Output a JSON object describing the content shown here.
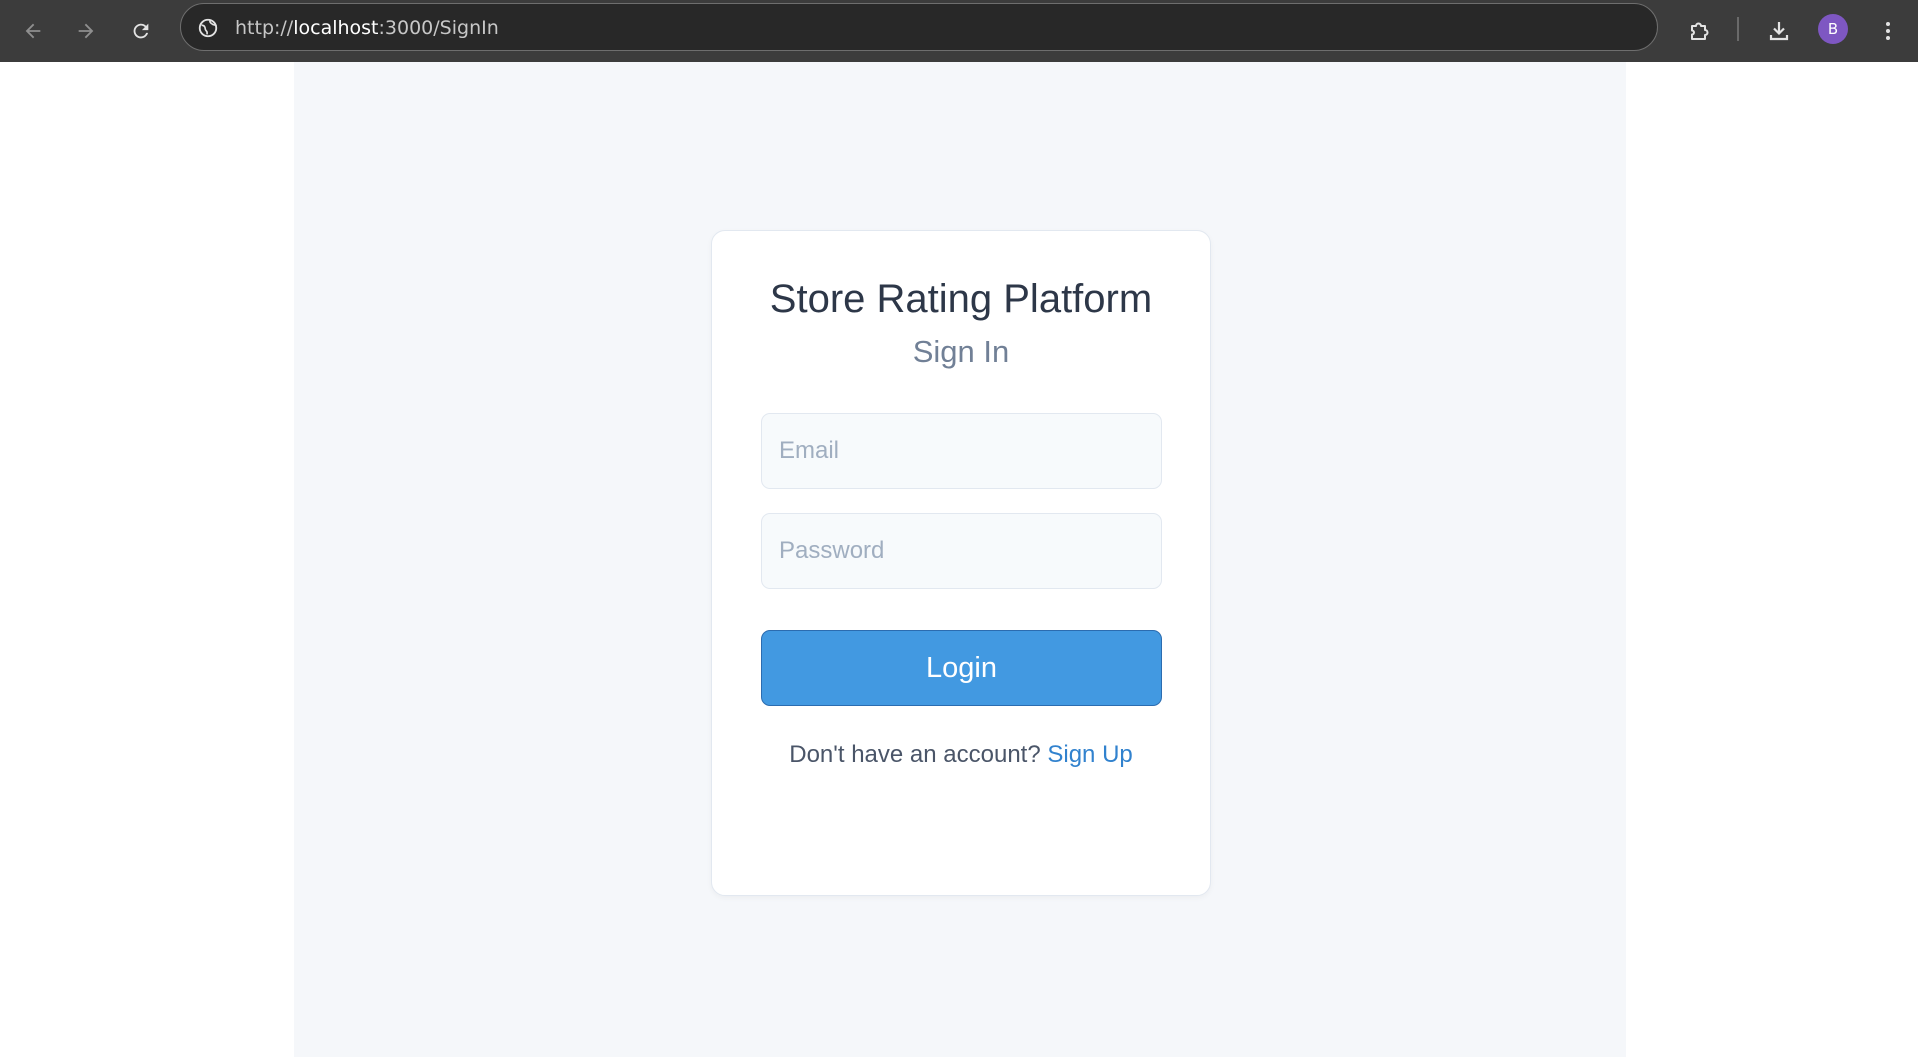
{
  "browser": {
    "url_scheme": "http://",
    "url_host": "localhost",
    "url_rest": ":3000/SignIn",
    "profile_initial": "B",
    "icons": {
      "back": "arrow-left-icon",
      "forward": "arrow-right-icon",
      "reload": "reload-icon",
      "site_info": "site-info-icon",
      "extensions": "puzzle-icon",
      "downloads": "download-icon",
      "menu": "kebab-menu-icon"
    }
  },
  "signin": {
    "title": "Store Rating Platform",
    "subtitle": "Sign In",
    "email_placeholder": "Email",
    "password_placeholder": "Password",
    "login_label": "Login",
    "no_account_text": "Don't have an account?",
    "signup_link": "Sign Up"
  },
  "colors": {
    "primary_button": "#4299e1",
    "link": "#3182ce",
    "page_background": "#f5f7fa",
    "browser_chrome": "#3c3c3c",
    "avatar": "#7e57c2"
  }
}
